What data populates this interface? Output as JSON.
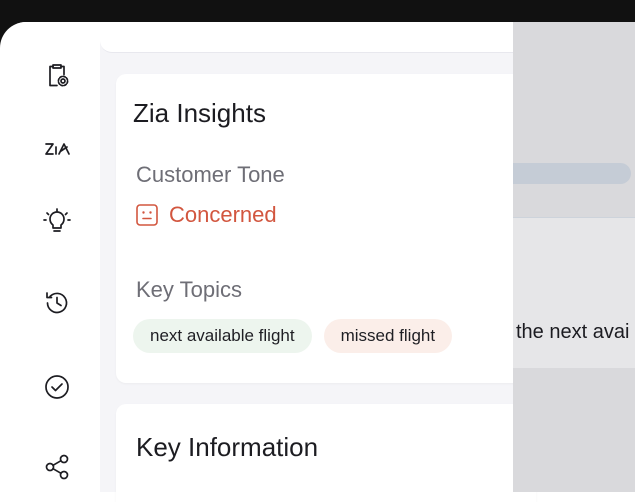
{
  "insights": {
    "title": "Zia Insights",
    "tone_label": "Customer Tone",
    "tone_value": "Concerned",
    "tone_icon": "neutral-face-icon",
    "topics_label": "Key Topics",
    "topics": [
      {
        "label": "next available flight",
        "color": "#edf5ee"
      },
      {
        "label": "missed flight",
        "color": "#fbeee9"
      }
    ]
  },
  "key_information": {
    "title": "Key Information"
  },
  "overlay": {
    "snippet": "the next avai"
  },
  "sidebar": {
    "icons": [
      "clipboard-settings-icon",
      "zia-logo-icon",
      "lightbulb-icon",
      "history-icon",
      "check-circle-icon",
      "share-icon"
    ]
  },
  "colors": {
    "tone": "#d2563f",
    "accent_text": "#1c1c21"
  }
}
